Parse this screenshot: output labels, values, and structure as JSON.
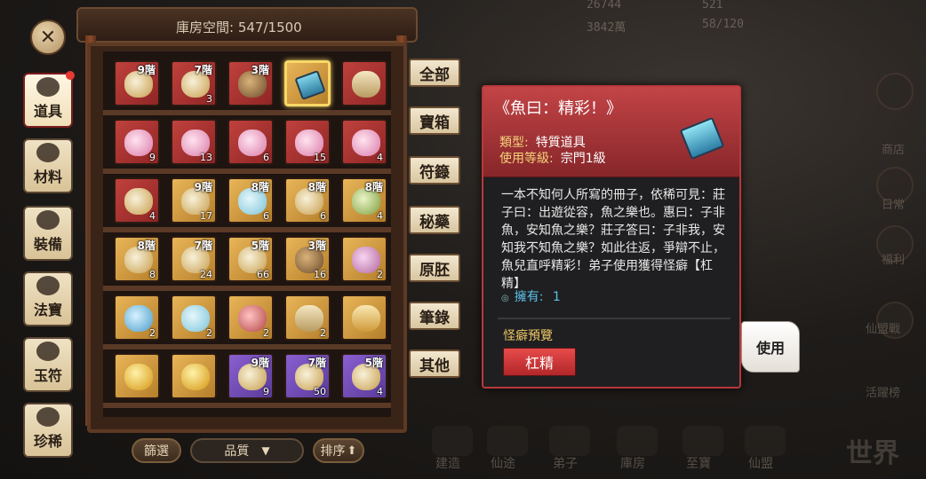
{
  "header": {
    "storage_label": "庫房空間:",
    "storage_value": "547/1500"
  },
  "categories": [
    {
      "label": "道具",
      "icon": "bag-icon",
      "active": true,
      "has_dot": true
    },
    {
      "label": "材料",
      "icon": "herb-icon",
      "active": false
    },
    {
      "label": "裝備",
      "icon": "armor-icon",
      "active": false
    },
    {
      "label": "法寶",
      "icon": "artifact-icon",
      "active": false
    },
    {
      "label": "玉符",
      "icon": "talisman-icon",
      "active": false
    },
    {
      "label": "珍稀",
      "icon": "chest-icon",
      "active": false
    }
  ],
  "filters": [
    "全部",
    "寶箱",
    "符籙",
    "秘藥",
    "原胚",
    "筆錄",
    "其他"
  ],
  "grid": [
    [
      {
        "r": "red",
        "tier": "9階",
        "count": "",
        "icon": "fox-icon"
      },
      {
        "r": "red",
        "tier": "7階",
        "count": "3",
        "icon": "fox-icon"
      },
      {
        "r": "red",
        "tier": "3階",
        "count": "",
        "icon": "gourd-icon"
      },
      {
        "r": "gold",
        "tier": "",
        "count": "",
        "icon": "book-icon",
        "selected": true
      },
      {
        "r": "red",
        "tier": "",
        "count": "",
        "icon": "scroll-icon"
      }
    ],
    [
      {
        "r": "red",
        "tier": "",
        "count": "9",
        "icon": "lotus-icon"
      },
      {
        "r": "red",
        "tier": "",
        "count": "13",
        "icon": "lotus-icon"
      },
      {
        "r": "red",
        "tier": "",
        "count": "6",
        "icon": "lotus-icon"
      },
      {
        "r": "red",
        "tier": "",
        "count": "15",
        "icon": "lotus-icon"
      },
      {
        "r": "red",
        "tier": "",
        "count": "4",
        "icon": "lotus-icon"
      }
    ],
    [
      {
        "r": "red",
        "tier": "",
        "count": "4",
        "icon": "fox-icon"
      },
      {
        "r": "gold",
        "tier": "9階",
        "count": "17",
        "icon": "fox-icon"
      },
      {
        "r": "gold",
        "tier": "8階",
        "count": "6",
        "icon": "cloud-icon"
      },
      {
        "r": "gold",
        "tier": "8階",
        "count": "6",
        "icon": "fox-icon"
      },
      {
        "r": "gold",
        "tier": "8階",
        "count": "4",
        "icon": "leaf-icon"
      }
    ],
    [
      {
        "r": "gold",
        "tier": "8階",
        "count": "8",
        "icon": "fox-icon"
      },
      {
        "r": "gold",
        "tier": "7階",
        "count": "24",
        "icon": "fox-icon"
      },
      {
        "r": "gold",
        "tier": "5階",
        "count": "66",
        "icon": "fox-icon"
      },
      {
        "r": "gold",
        "tier": "3階",
        "count": "16",
        "icon": "gourd-icon"
      },
      {
        "r": "gold",
        "tier": "",
        "count": "2",
        "icon": "potion-icon"
      }
    ],
    [
      {
        "r": "gold",
        "tier": "",
        "count": "2",
        "icon": "dragon-icon"
      },
      {
        "r": "gold",
        "tier": "",
        "count": "2",
        "icon": "cloud-icon"
      },
      {
        "r": "gold",
        "tier": "",
        "count": "2",
        "icon": "bowl-icon"
      },
      {
        "r": "gold",
        "tier": "",
        "count": "2",
        "icon": "scroll-icon"
      },
      {
        "r": "gold",
        "tier": "",
        "count": "",
        "icon": "paper-icon"
      }
    ],
    [
      {
        "r": "gold",
        "tier": "",
        "count": "",
        "icon": "orb-icon"
      },
      {
        "r": "gold",
        "tier": "",
        "count": "",
        "icon": "orb-icon"
      },
      {
        "r": "purple",
        "tier": "9階",
        "count": "9",
        "icon": "fox-icon"
      },
      {
        "r": "purple",
        "tier": "7階",
        "count": "50",
        "icon": "fox-icon"
      },
      {
        "r": "purple",
        "tier": "5階",
        "count": "4",
        "icon": "fox-icon"
      }
    ]
  ],
  "controls": {
    "filter": "篩選",
    "quality": "品質",
    "sort": "排序"
  },
  "item": {
    "title": "《魚曰：精彩！》",
    "type_key": "類型:",
    "type_val": "特質道具",
    "level_key": "使用等級:",
    "level_val": "宗門1級",
    "description": "一本不知何人所寫的冊子，依稀可見：莊子曰：出遊從容，魚之樂也。惠曰：子非魚，安知魚之樂？莊子答曰：子非我，安知我不知魚之樂？如此往返，爭辯不止，魚兒直呼精彩！弟子使用獲得怪癖【杠精】",
    "own_label": "擁有:",
    "own_value": "1",
    "preview_label": "怪癖預覽",
    "trait": "杠精"
  },
  "use_button": "使用",
  "background": {
    "stats": [
      "26744",
      "521",
      "3842萬",
      "58/120"
    ],
    "right_labels": [
      "商店",
      "日常",
      "福利",
      "仙盟戰",
      "活躍榜"
    ],
    "bottom_labels": [
      "建造",
      "仙途",
      "弟子",
      "庫房",
      "至寶",
      "仙盟"
    ],
    "world": "世界"
  }
}
